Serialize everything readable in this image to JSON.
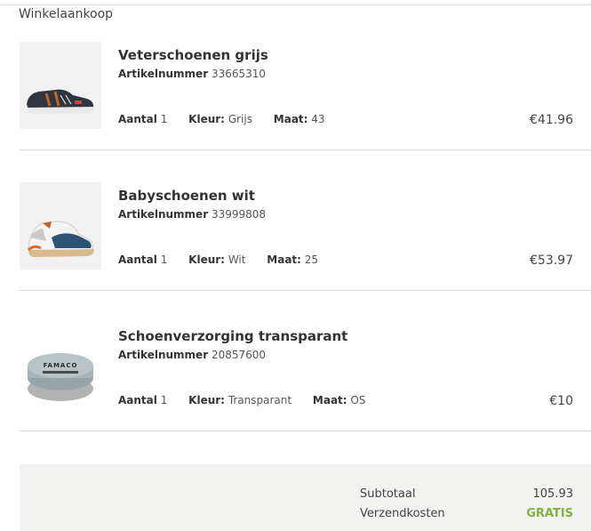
{
  "section_title": "Winkelaankoop",
  "labels": {
    "article_number": "Artikelnummer",
    "quantity": "Aantal",
    "color": "Kleur:",
    "size": "Maat:"
  },
  "items": [
    {
      "name": "Veterschoenen grijs",
      "article_number": "33665310",
      "quantity": "1",
      "color": "Grijs",
      "size": "43",
      "price": "€41.96",
      "image_icon": "sneaker-gray"
    },
    {
      "name": "Babyschoenen wit",
      "article_number": "33999808",
      "quantity": "1",
      "color": "Wit",
      "size": "25",
      "price": "€53.97",
      "image_icon": "sneaker-white-blue"
    },
    {
      "name": "Schoenverzorging transparant",
      "article_number": "20857600",
      "quantity": "1",
      "color": "Transparant",
      "size": "OS",
      "price": "€10",
      "image_icon": "famaco-tin",
      "image_text": "FAMACO"
    }
  ],
  "summary": {
    "subtotal_label": "Subtotaal",
    "subtotal_value": "105.93",
    "shipping_label": "Verzendkosten",
    "shipping_value": "GRATIS"
  },
  "colors": {
    "free_shipping": "#7fb241",
    "summary_bg": "#f2f2f0"
  }
}
